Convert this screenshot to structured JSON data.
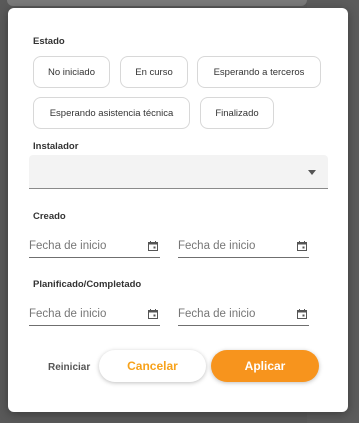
{
  "status": {
    "label": "Estado",
    "options": [
      "No iniciado",
      "En curso",
      "Esperando a terceros",
      "Esperando asistencia técnica",
      "Finalizado"
    ]
  },
  "installer": {
    "label": "Instalador",
    "value": ""
  },
  "created": {
    "label": "Creado",
    "start_placeholder": "Fecha de inicio",
    "end_placeholder": "Fecha de inicio"
  },
  "planned": {
    "label": "Planificado/Completado",
    "start_placeholder": "Fecha de inicio",
    "end_placeholder": "Fecha de inicio"
  },
  "actions": {
    "reset": "Reiniciar",
    "cancel": "Cancelar",
    "apply": "Aplicar"
  },
  "colors": {
    "accent": "#f7941d",
    "overlay": "#595959"
  }
}
